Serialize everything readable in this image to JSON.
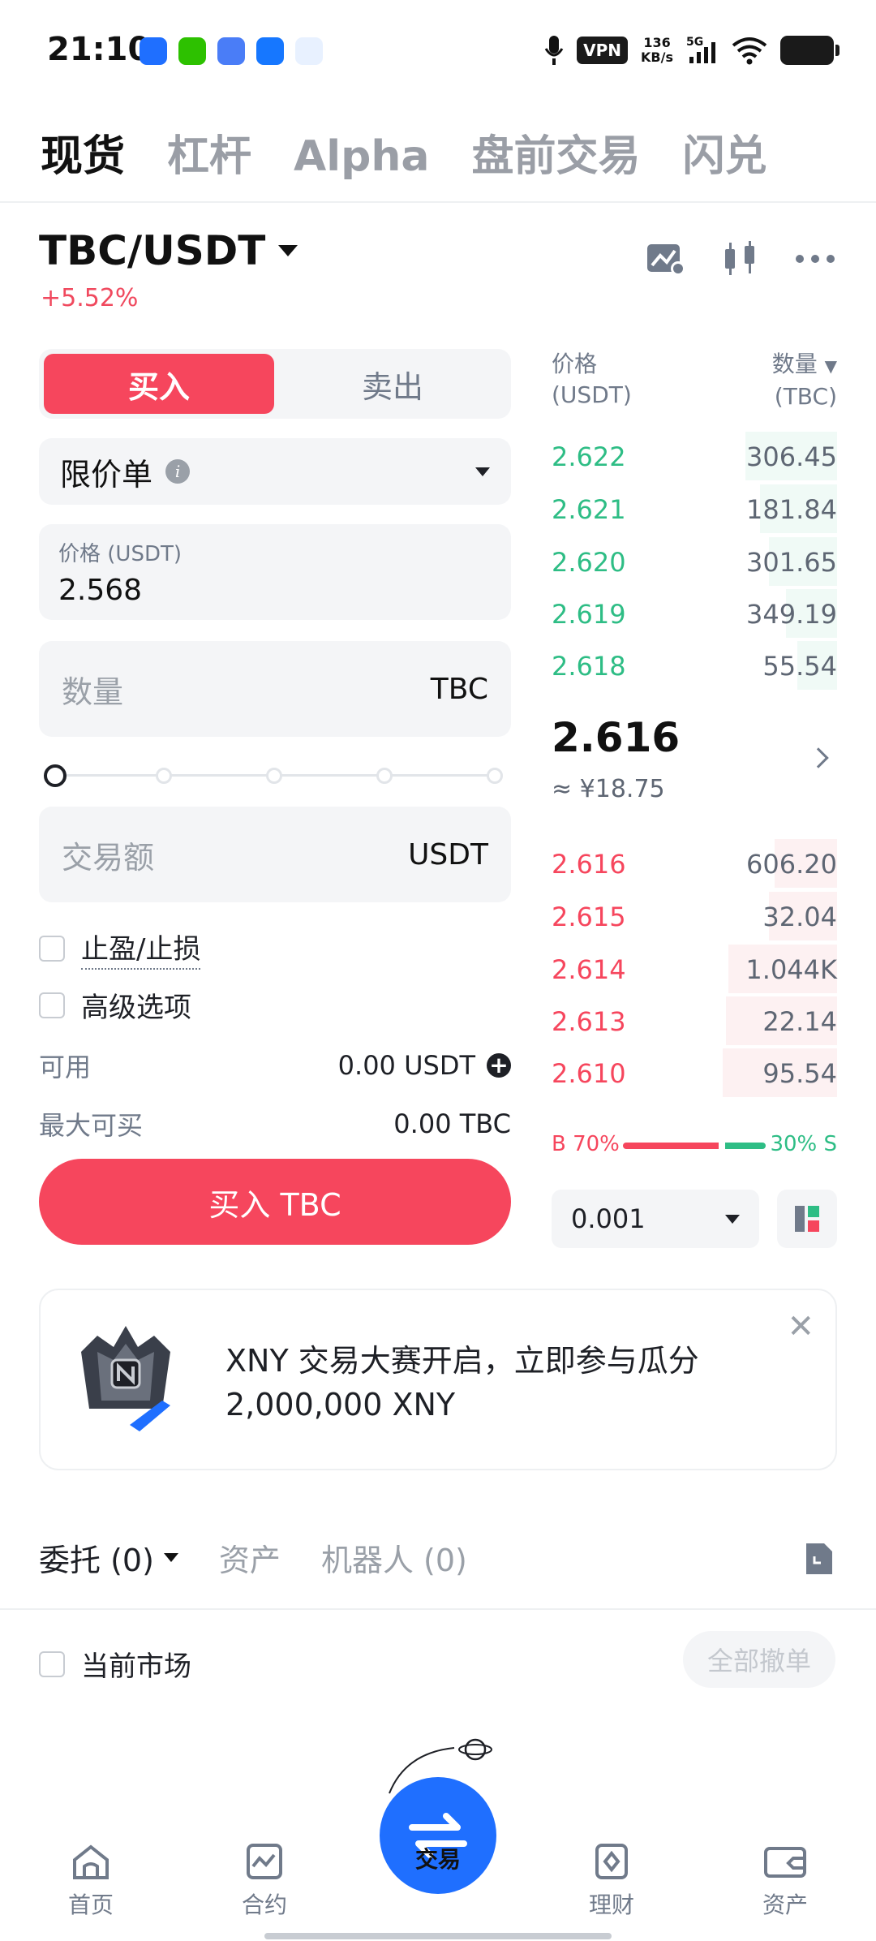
{
  "status_bar": {
    "time": "21:10",
    "vpn": "VPN",
    "net_speed_value": "136",
    "net_speed_unit": "KB/s",
    "network": "5G"
  },
  "top_tabs": [
    "现货",
    "杠杆",
    "Alpha",
    "盘前交易",
    "闪兑"
  ],
  "pair": {
    "name": "TBC/USDT",
    "change": "+5.52%"
  },
  "trade_form": {
    "buy_label": "买入",
    "sell_label": "卖出",
    "order_type": "限价单",
    "price_label": "价格 (USDT)",
    "price_value": "2.568",
    "qty_placeholder": "数量",
    "qty_unit": "TBC",
    "total_placeholder": "交易额",
    "total_unit": "USDT",
    "tp_sl_label": "止盈/止损",
    "advanced_label": "高级选项",
    "available_label": "可用",
    "available_value": "0.00 USDT",
    "max_buy_label": "最大可买",
    "max_buy_value": "0.00 TBC",
    "submit_label": "买入 TBC"
  },
  "order_book": {
    "price_header": "价格",
    "price_unit": "(USDT)",
    "qty_header": "数量",
    "qty_unit": "(TBC)",
    "asks": [
      {
        "price": "2.622",
        "qty": "306.45",
        "depth": 0.32
      },
      {
        "price": "2.621",
        "qty": "181.84",
        "depth": 0.27
      },
      {
        "price": "2.620",
        "qty": "301.65",
        "depth": 0.24
      },
      {
        "price": "2.619",
        "qty": "349.19",
        "depth": 0.18
      },
      {
        "price": "2.618",
        "qty": "55.54",
        "depth": 0.14
      }
    ],
    "mid_price": "2.616",
    "mid_fiat": "≈ ¥18.75",
    "bids": [
      {
        "price": "2.616",
        "qty": "606.20",
        "depth": 0.22
      },
      {
        "price": "2.615",
        "qty": "32.04",
        "depth": 0.24
      },
      {
        "price": "2.614",
        "qty": "1.044K",
        "depth": 0.38
      },
      {
        "price": "2.613",
        "qty": "22.14",
        "depth": 0.39
      },
      {
        "price": "2.610",
        "qty": "95.54",
        "depth": 0.4
      }
    ],
    "buy_ratio_label": "B 70%",
    "sell_ratio_label": "30% S",
    "buy_ratio": 0.7,
    "precision": "0.001"
  },
  "banner": {
    "text_line1": "XNY 交易大赛开启，立即参与瓜分",
    "text_line2": "2,000,000 XNY"
  },
  "orders": {
    "tabs": [
      "委托 (0)",
      "资产",
      "机器人 (0)"
    ],
    "current_market_label": "当前市场",
    "cancel_all_label": "全部撤单"
  },
  "nav": {
    "items": [
      "首页",
      "合约",
      "交易",
      "理财",
      "资产"
    ]
  },
  "colors": {
    "buy": "#f6465d",
    "sell": "#2ebd85",
    "fab": "#1f6fff"
  }
}
